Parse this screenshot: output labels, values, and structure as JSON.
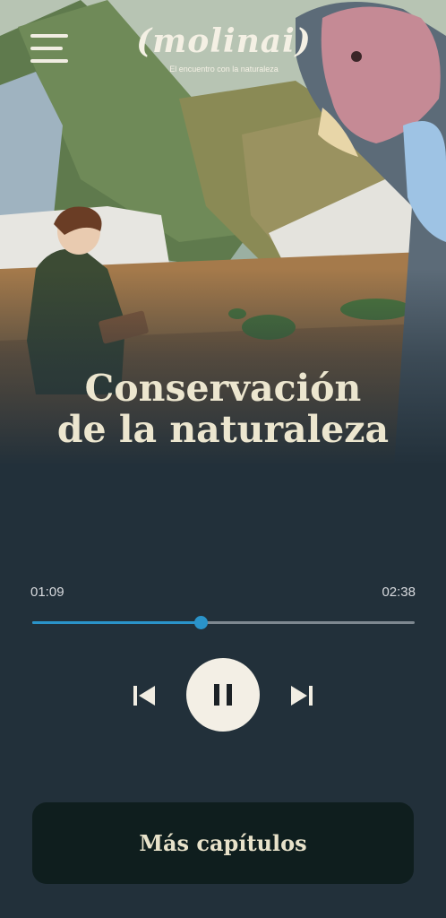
{
  "brand": {
    "logo": "(molinai)",
    "tagline": "El encuentro con la naturaleza"
  },
  "icons": {
    "menu": "hamburger-menu-icon",
    "previous": "skip-previous-icon",
    "pause": "pause-icon",
    "next": "skip-next-icon"
  },
  "episode": {
    "title_line1": "Conservación",
    "title_line2": "de la naturaleza"
  },
  "player": {
    "current_time": "01:09",
    "total_time": "02:38",
    "progress": 0.44,
    "state": "playing"
  },
  "actions": {
    "more_chapters": "Más capítulos"
  },
  "colors": {
    "background": "#22303a",
    "accent": "#2a93c9",
    "button_dark": "#0f1e1e",
    "title": "#ece6cf"
  }
}
